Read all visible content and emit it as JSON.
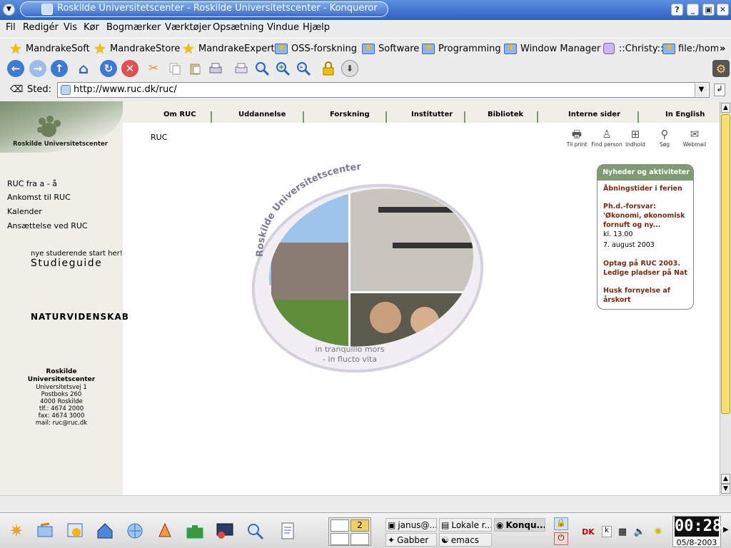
{
  "window": {
    "title": "Roskilde Universitetscenter - Roskilde Universitetscenter - Konqueror",
    "buttons": [
      "?",
      "minimize",
      "maximize",
      "close"
    ]
  },
  "menu": [
    "Fil",
    "Redigér",
    "Vis",
    "Kør",
    "Bogmærker",
    "Værktøjer",
    "Opsætning",
    "Vindue",
    "Hjælp"
  ],
  "bookmarks": [
    {
      "label": "MandrakeSoft",
      "icon": "star-icon"
    },
    {
      "label": "MandrakeStore",
      "icon": "star-icon"
    },
    {
      "label": "MandrakeExpert",
      "icon": "star-icon"
    },
    {
      "label": "OSS-forskning",
      "icon": "folder-icon"
    },
    {
      "label": "Software",
      "icon": "folder-icon"
    },
    {
      "label": "Programming",
      "icon": "folder-icon"
    },
    {
      "label": "Window Manager",
      "icon": "folder-icon"
    },
    {
      "label": "::Christy::",
      "icon": "web-icon"
    },
    {
      "label": "file:/home",
      "icon": "folder-icon"
    }
  ],
  "location": {
    "label": "Sted:",
    "url": "http://www.ruc.dk/ruc/"
  },
  "site": {
    "logo_name": "Roskilde Universitetscenter",
    "nav": [
      "Om RUC",
      "Uddannelse",
      "Forskning",
      "Institutter",
      "Bibliotek",
      "Interne sider",
      "In English"
    ],
    "breadcrumb": "RUC",
    "tools": [
      "Til print",
      "Find person",
      "Indhold",
      "Søg",
      "Webmail"
    ],
    "side_links": [
      "RUC fra a - å",
      "Ankomst til RUC",
      "Kalender",
      "Ansættelse ved RUC"
    ],
    "studieguide_pre": "nye studerende start her!",
    "studieguide": "Studieguide",
    "naturvidenskab": "NATURVIDENSKAB",
    "address": {
      "name1": "Roskilde",
      "name2": "Universitetscenter",
      "lines": [
        "Universitetsvej 1",
        "Postboks 260",
        "4000 Roskilde",
        "tlf.: 4674 2000",
        "fax: 4674 3000",
        "mail: ruc@ruc.dk"
      ]
    },
    "emblem": {
      "arc_text": "Roskilde Universitetscenter",
      "motto1": "in tranquillo mors",
      "motto2": "- in flucto vita"
    },
    "news": {
      "title": "Nyheder og aktiviteter",
      "items": [
        {
          "link": "Åbningstider i ferien"
        },
        {
          "link": "Ph.d.-forsvar: 'Økonomi, økonomisk fornuft og ny...",
          "time": "kl. 13.00",
          "date": "7. august 2003"
        },
        {
          "link": "Optag på RUC 2003. Ledige pladser på Nat"
        },
        {
          "link": "Husk fornyelse af årskort"
        }
      ]
    }
  },
  "taskbar": {
    "desktop_number": "2",
    "tasks": [
      "janus@...",
      "Lokale r...",
      "Konqu...",
      "Gabber",
      "emacs"
    ],
    "clock_time": "00:28",
    "clock_date": "05/8-2003"
  }
}
